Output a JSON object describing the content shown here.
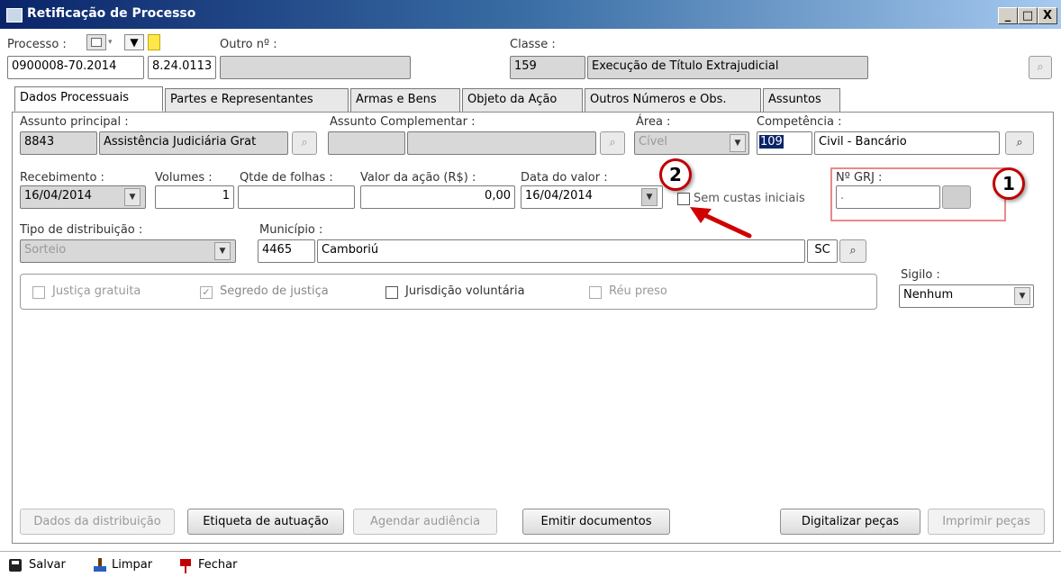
{
  "window": {
    "title": "Retificação de Processo",
    "controls": {
      "minimize": "_",
      "maximize": "□",
      "close": "X"
    }
  },
  "header": {
    "processo_label": "Processo :",
    "processo_number": "0900008-70.2014",
    "processo_suffix": "8.24.0113",
    "outro_label": "Outro nº :",
    "outro_value": "",
    "classe_label": "Classe :",
    "classe_code": "159",
    "classe_name": "Execução de Título Extrajudicial"
  },
  "tabs": [
    {
      "label": "Dados Processuais"
    },
    {
      "label": "Partes e Representantes"
    },
    {
      "label": "Armas e Bens"
    },
    {
      "label": "Objeto da Ação"
    },
    {
      "label": "Outros Números e Obs."
    },
    {
      "label": "Assuntos"
    }
  ],
  "form": {
    "assunto_principal_label": "Assunto principal :",
    "assunto_principal_code": "8843",
    "assunto_principal_name": "Assistência Judiciária Grat",
    "assunto_complementar_label": "Assunto Complementar :",
    "area_label": "Área :",
    "area_value": "Cível",
    "competencia_label": "Competência :",
    "competencia_code": "109",
    "competencia_name": "Civil - Bancário",
    "recebimento_label": "Recebimento :",
    "recebimento_value": "16/04/2014",
    "volumes_label": "Volumes :",
    "volumes_value": "1",
    "folhas_label": "Qtde de folhas :",
    "folhas_value": "",
    "valor_label": "Valor da ação (R$) :",
    "valor_value": "0,00",
    "data_valor_label": "Data do valor :",
    "data_valor_value": "16/04/2014",
    "sem_custas_label": "Sem custas iniciais",
    "grj_label": "Nº GRJ :",
    "grj_value": ".",
    "tipo_distribuicao_label": "Tipo de distribuição :",
    "tipo_distribuicao_value": "Sorteio",
    "municipio_label": "Município :",
    "municipio_code": "4465",
    "municipio_name": "Camboriú",
    "municipio_uf": "SC",
    "sigilo_label": "Sigilo :",
    "sigilo_value": "Nenhum"
  },
  "checkboxes": [
    {
      "label": "Justiça gratuita",
      "checked": false,
      "enabled": false
    },
    {
      "label": "Segredo de justiça",
      "checked": true,
      "enabled": false
    },
    {
      "label": "Jurisdição voluntária",
      "checked": false,
      "enabled": true
    },
    {
      "label": "Réu preso",
      "checked": false,
      "enabled": false
    }
  ],
  "buttons": {
    "dados_distribuicao": "Dados da distribuição",
    "etiqueta": "Etiqueta de autuação",
    "agendar": "Agendar audiência",
    "emitir": "Emitir documentos",
    "digitalizar": "Digitalizar peças",
    "imprimir": "Imprimir peças"
  },
  "footer": {
    "salvar": "Salvar",
    "limpar": "Limpar",
    "fechar": "Fechar"
  },
  "annotations": {
    "badge1": "1",
    "badge2": "2",
    "highlight_color": "#e88a8a",
    "arrow_color": "#d00000"
  }
}
